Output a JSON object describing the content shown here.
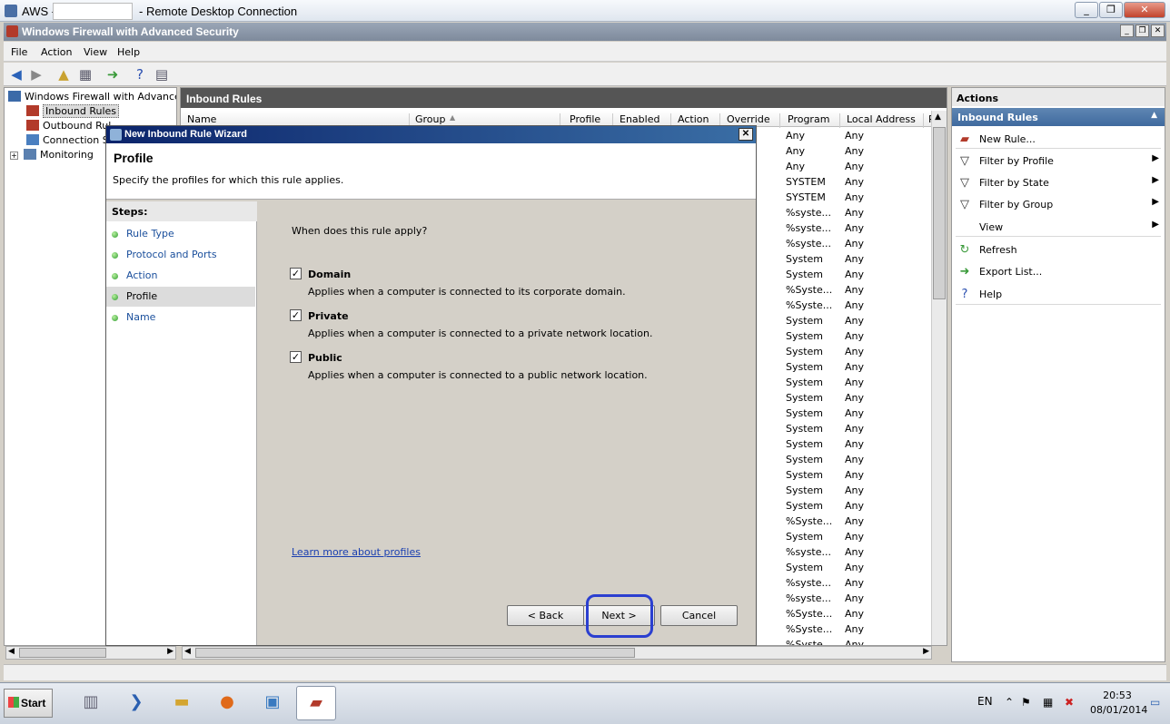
{
  "rdp": {
    "title_prefix": "AWS -",
    "title_suffix": "- Remote Desktop Connection"
  },
  "app": {
    "title": "Windows Firewall with Advanced Security",
    "menu": [
      "File",
      "Action",
      "View",
      "Help"
    ]
  },
  "tree": {
    "root": "Windows Firewall with Advanced S",
    "items": [
      {
        "label": "Inbound Rules",
        "selected": true
      },
      {
        "label": "Outbound Rul"
      },
      {
        "label": "Connection Se"
      },
      {
        "label": "Monitoring"
      }
    ]
  },
  "center": {
    "title": "Inbound Rules",
    "columns": [
      "Name",
      "Group",
      "Profile",
      "Enabled",
      "Action",
      "Override",
      "Program",
      "Local Address",
      "R"
    ],
    "rows": [
      [
        "Any",
        "Any"
      ],
      [
        "Any",
        "Any"
      ],
      [
        "Any",
        "Any"
      ],
      [
        "SYSTEM",
        "Any"
      ],
      [
        "SYSTEM",
        "Any"
      ],
      [
        "%syste...",
        "Any"
      ],
      [
        "%syste...",
        "Any"
      ],
      [
        "%syste...",
        "Any"
      ],
      [
        "System",
        "Any"
      ],
      [
        "System",
        "Any"
      ],
      [
        "%Syste...",
        "Any"
      ],
      [
        "%Syste...",
        "Any"
      ],
      [
        "System",
        "Any"
      ],
      [
        "System",
        "Any"
      ],
      [
        "System",
        "Any"
      ],
      [
        "System",
        "Any"
      ],
      [
        "System",
        "Any"
      ],
      [
        "System",
        "Any"
      ],
      [
        "System",
        "Any"
      ],
      [
        "System",
        "Any"
      ],
      [
        "System",
        "Any"
      ],
      [
        "System",
        "Any"
      ],
      [
        "System",
        "Any"
      ],
      [
        "System",
        "Any"
      ],
      [
        "System",
        "Any"
      ],
      [
        "%Syste...",
        "Any"
      ],
      [
        "System",
        "Any"
      ],
      [
        "%syste...",
        "Any"
      ],
      [
        "System",
        "Any"
      ],
      [
        "%syste...",
        "Any"
      ],
      [
        "%syste...",
        "Any"
      ],
      [
        "%Syste...",
        "Any"
      ],
      [
        "%Syste...",
        "Any"
      ],
      [
        "%Syste...",
        "Any"
      ]
    ]
  },
  "actions": {
    "title": "Actions",
    "section": "Inbound Rules",
    "items": [
      {
        "label": "New Rule...",
        "icon": "new-rule-icon"
      },
      {
        "label": "Filter by Profile",
        "icon": "filter-icon",
        "submenu": true
      },
      {
        "label": "Filter by State",
        "icon": "filter-icon",
        "submenu": true
      },
      {
        "label": "Filter by Group",
        "icon": "filter-icon",
        "submenu": true
      },
      {
        "label": "View",
        "icon": "",
        "submenu": true
      },
      {
        "label": "Refresh",
        "icon": "refresh-icon"
      },
      {
        "label": "Export List...",
        "icon": "export-icon"
      },
      {
        "label": "Help",
        "icon": "help-icon"
      }
    ]
  },
  "wizard": {
    "title": "New Inbound Rule Wizard",
    "heading": "Profile",
    "subheading": "Specify the profiles for which this rule applies.",
    "steps_title": "Steps:",
    "steps": [
      "Rule Type",
      "Protocol and Ports",
      "Action",
      "Profile",
      "Name"
    ],
    "current_step": "Profile",
    "question": "When does this rule apply?",
    "options": [
      {
        "label": "Domain",
        "checked": true,
        "desc": "Applies when a computer is connected to its corporate domain."
      },
      {
        "label": "Private",
        "checked": true,
        "desc": "Applies when a computer is connected to a private network location."
      },
      {
        "label": "Public",
        "checked": true,
        "desc": "Applies when a computer is connected to a public network location."
      }
    ],
    "link": "Learn more about profiles",
    "buttons": {
      "back": "< Back",
      "next": "Next >",
      "cancel": "Cancel"
    }
  },
  "taskbar": {
    "start": "Start",
    "lang": "EN",
    "time": "20:53",
    "date": "08/01/2014"
  }
}
